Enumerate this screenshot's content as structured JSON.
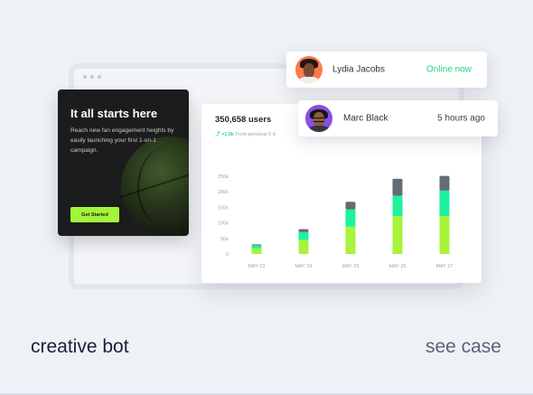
{
  "promo": {
    "title": "It all starts here",
    "description": "Reach new fan engagement heights by easily launching your first 1-on-1 campaign.",
    "cta": "Get Started"
  },
  "stats": {
    "users": "350,658 users",
    "delta": "+1.5k",
    "delta_caption": "From previous 5 d"
  },
  "notifications": [
    {
      "name": "Lydia Jacobs",
      "status": "Online now",
      "avatar_color": "#ff7a4a",
      "status_color": "#21d882"
    },
    {
      "name": "Marc Black",
      "status": "5 hours ago",
      "avatar_color": "#8a4fe0",
      "status_color": "#3d4048"
    }
  ],
  "chart_data": {
    "type": "bar",
    "stacked": true,
    "categories": [
      "MAY 23",
      "MAY 24",
      "MAY 25",
      "MAY 26",
      "MAY 27"
    ],
    "y_ticks": [
      "0",
      "50k",
      "100k",
      "150k",
      "200k",
      "250k"
    ],
    "ylim": [
      0,
      250000
    ],
    "grid": false,
    "series": [
      {
        "color": "#a7f43a",
        "values": [
          18000,
          45000,
          88000,
          122000,
          122000
        ]
      },
      {
        "color": "#1ef29c",
        "values": [
          10000,
          25000,
          55000,
          65000,
          82000
        ]
      },
      {
        "color": "#646c76",
        "values": [
          3000,
          10000,
          25000,
          55000,
          47000
        ]
      }
    ]
  },
  "footer": {
    "title": "creative bot",
    "link": "see case"
  }
}
